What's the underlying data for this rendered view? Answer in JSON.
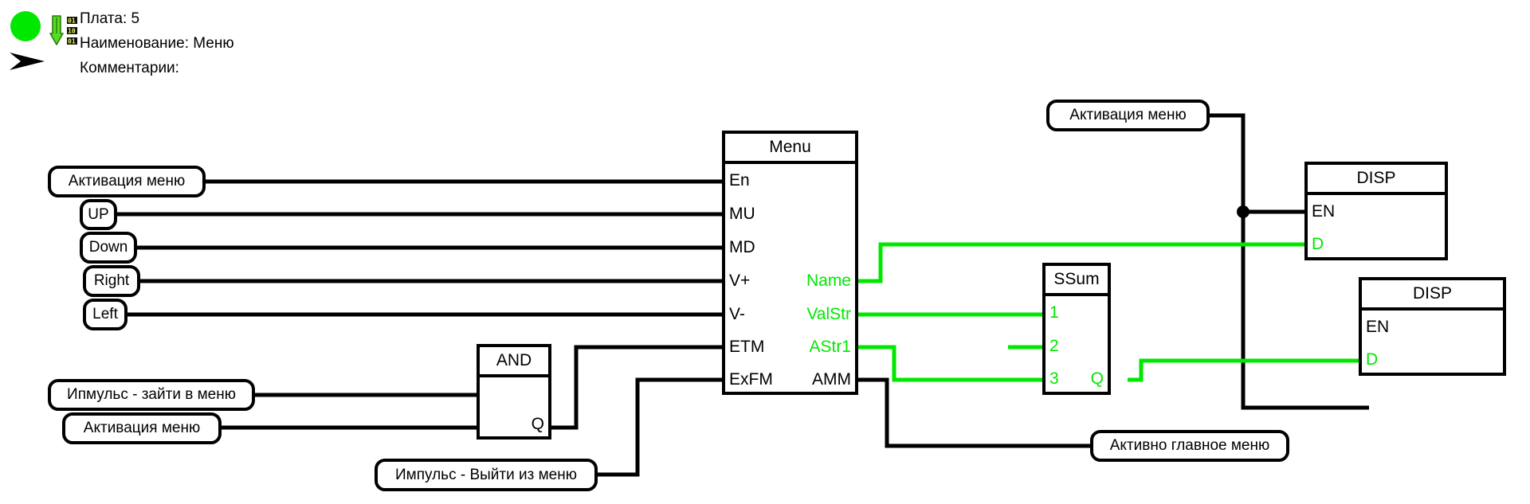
{
  "header": {
    "icons": {
      "status": "green-circle-icon",
      "download": "download-binary-icon",
      "arrow": "black-arrow-icon"
    },
    "board_line": "Плата: 5",
    "name_line": "Наименование: Меню",
    "comment_line": "Комментарии:"
  },
  "colors": {
    "wire_black": "#000000",
    "wire_green": "#00E800",
    "status_green": "#00E800",
    "background": "#ffffff"
  },
  "blocks": {
    "menu": {
      "title": "Menu",
      "inputs": [
        "En",
        "MU",
        "MD",
        "V+",
        "V-",
        "ETM",
        "ExFM"
      ],
      "outputs": [
        {
          "label": "Name",
          "color": "green"
        },
        {
          "label": "ValStr",
          "color": "green"
        },
        {
          "label": "AStr1",
          "color": "green"
        },
        {
          "label": "AMM",
          "color": "black"
        }
      ]
    },
    "and": {
      "title": "AND",
      "inputs": [],
      "outputs": [
        {
          "label": "Q",
          "color": "black"
        }
      ]
    },
    "ssum": {
      "title": "SSum",
      "inputs": [
        {
          "label": "1",
          "color": "green"
        },
        {
          "label": "2",
          "color": "green"
        },
        {
          "label": "3",
          "color": "green"
        }
      ],
      "outputs": [
        {
          "label": "Q",
          "color": "green"
        }
      ]
    },
    "disp_top": {
      "title": "DISP",
      "inputs": [
        {
          "label": "EN",
          "color": "black"
        },
        {
          "label": "D",
          "color": "green"
        }
      ]
    },
    "disp_bottom": {
      "title": "DISP",
      "inputs": [
        {
          "label": "EN",
          "color": "black"
        },
        {
          "label": "D",
          "color": "green"
        }
      ]
    }
  },
  "labels": {
    "activation_menu_left": "Активация  меню",
    "up": "UP",
    "down": "Down",
    "right": "Right",
    "left": "Left",
    "impulse_enter": "Ипмульс - зайти в меню",
    "activation_menu_and": "Активация  меню",
    "impulse_exit": "Импульс - Выйти из меню",
    "activation_menu_right": "Активация  меню",
    "active_main_menu": "Активно главное меню"
  }
}
